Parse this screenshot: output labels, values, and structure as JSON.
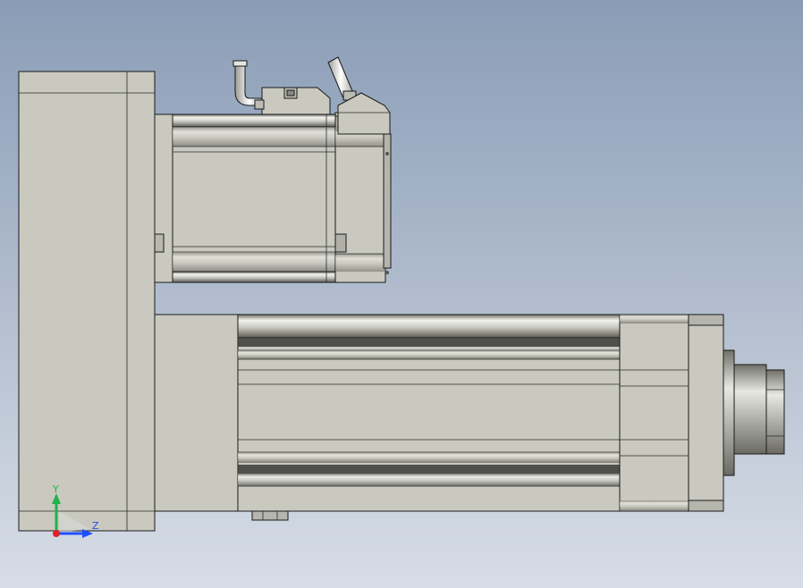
{
  "viewport": {
    "background_top": "#8a9cb6",
    "background_bottom": "#d7dde6"
  },
  "model": {
    "body_color": "#c9c9c0",
    "edge_color": "#1a1a1a",
    "parts": [
      "gearbox-housing",
      "servo-motor",
      "motor-cable-connector",
      "encoder-connector",
      "actuator-tube",
      "rear-end-block",
      "front-end-block",
      "front-flange",
      "piston-rod-end",
      "mounting-nut"
    ]
  },
  "triad": {
    "y_label": "Y",
    "z_label": "Z",
    "y_color": "#22b14c",
    "z_color": "#1f4fff",
    "origin_color": "#e0202a"
  }
}
